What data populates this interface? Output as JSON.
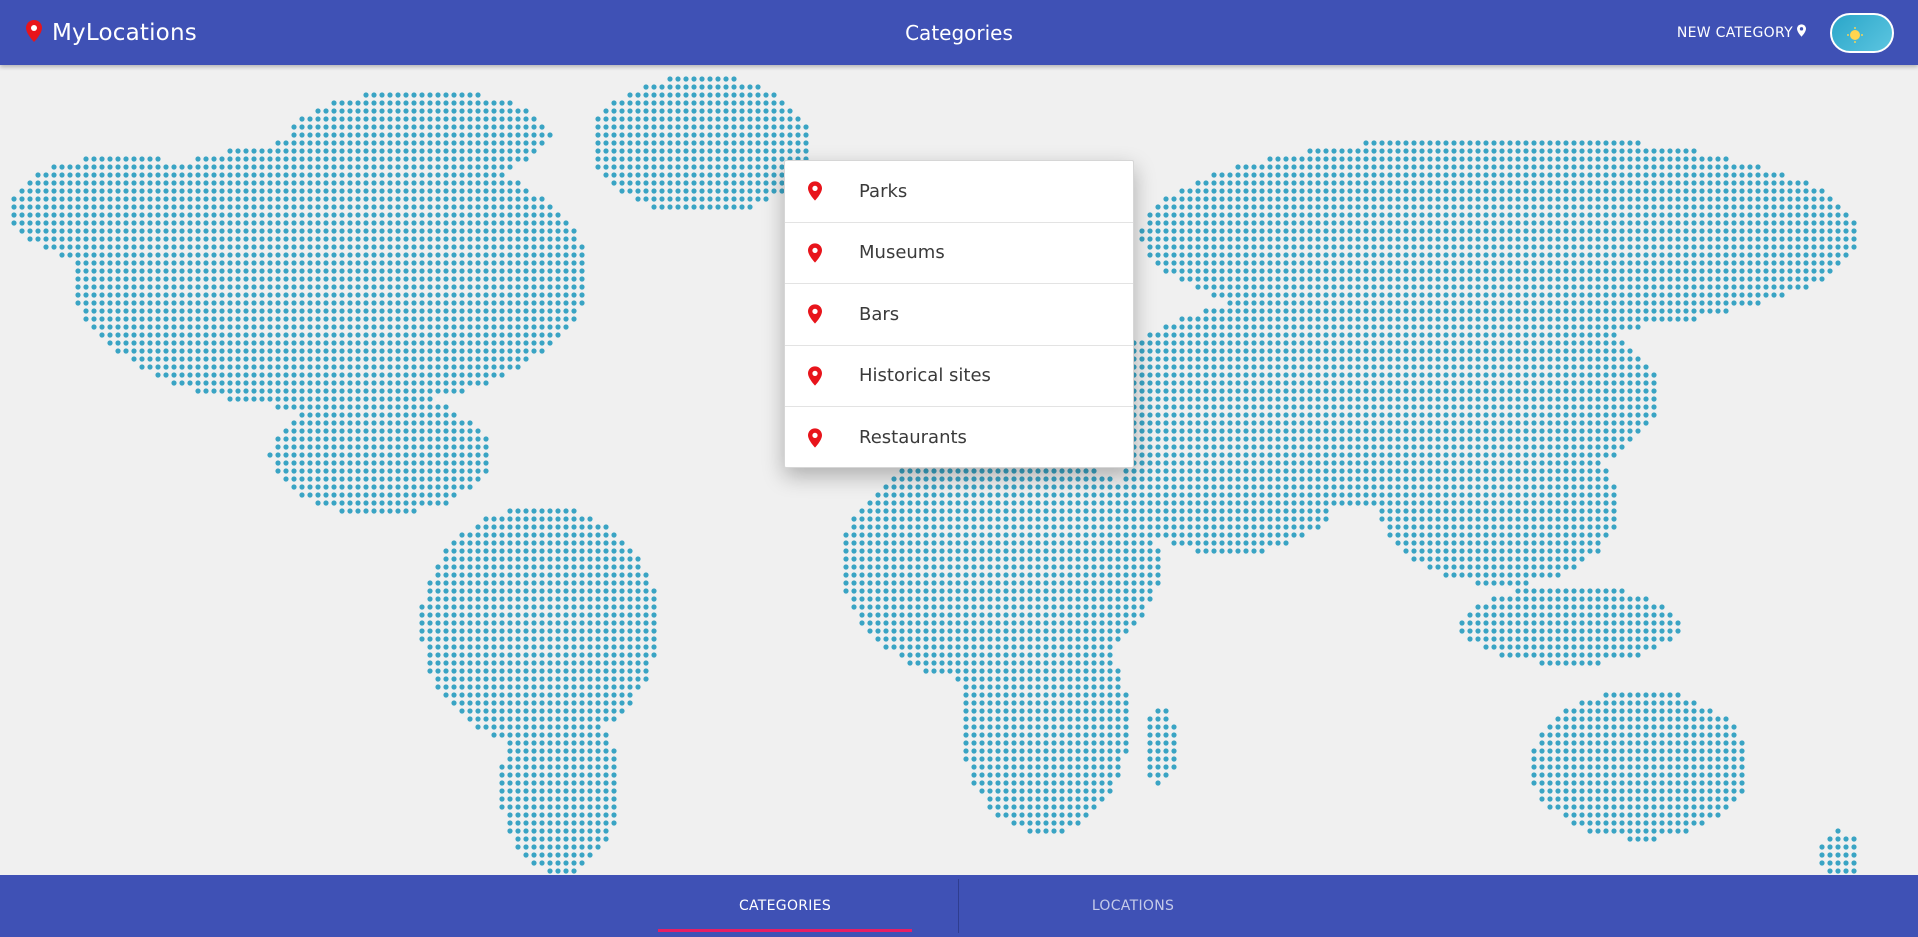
{
  "header": {
    "brand": "MyLocations",
    "title": "Categories",
    "new_category_label": "NEW CATEGORY",
    "brand_color": "#3f51b5",
    "pin_color": "#e8141b"
  },
  "categories": [
    {
      "label": "Parks",
      "icon": "map-pin-icon"
    },
    {
      "label": "Museums",
      "icon": "map-pin-icon"
    },
    {
      "label": "Bars",
      "icon": "map-pin-icon"
    },
    {
      "label": "Historical sites",
      "icon": "map-pin-icon"
    },
    {
      "label": "Restaurants",
      "icon": "map-pin-icon"
    }
  ],
  "map": {
    "dot_color": "#3aa4c4",
    "background": "#f0f0f0"
  },
  "tabs": [
    {
      "label": "CATEGORIES",
      "active": true
    },
    {
      "label": "LOCATIONS",
      "active": false
    }
  ],
  "theme_toggle": {
    "icon": "sun-icon",
    "state": "light"
  }
}
